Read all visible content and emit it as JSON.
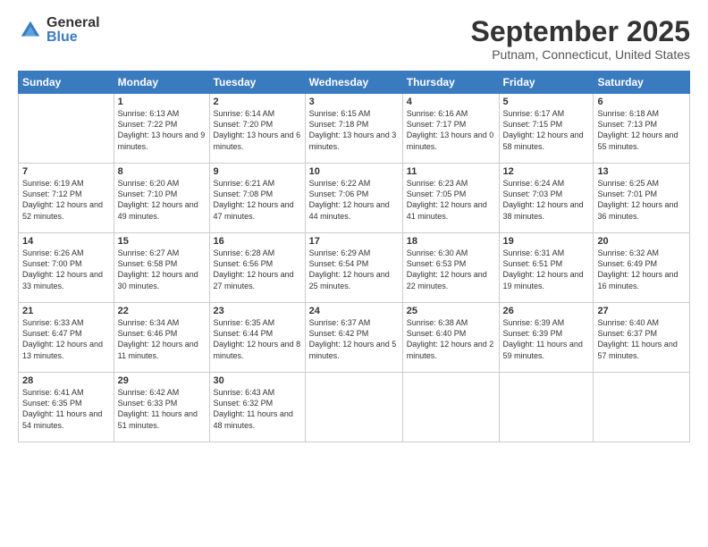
{
  "header": {
    "logo_general": "General",
    "logo_blue": "Blue",
    "title": "September 2025",
    "subtitle": "Putnam, Connecticut, United States"
  },
  "weekdays": [
    "Sunday",
    "Monday",
    "Tuesday",
    "Wednesday",
    "Thursday",
    "Friday",
    "Saturday"
  ],
  "weeks": [
    [
      {
        "day": null,
        "sunrise": null,
        "sunset": null,
        "daylight": null
      },
      {
        "day": "1",
        "sunrise": "Sunrise: 6:13 AM",
        "sunset": "Sunset: 7:22 PM",
        "daylight": "Daylight: 13 hours and 9 minutes."
      },
      {
        "day": "2",
        "sunrise": "Sunrise: 6:14 AM",
        "sunset": "Sunset: 7:20 PM",
        "daylight": "Daylight: 13 hours and 6 minutes."
      },
      {
        "day": "3",
        "sunrise": "Sunrise: 6:15 AM",
        "sunset": "Sunset: 7:18 PM",
        "daylight": "Daylight: 13 hours and 3 minutes."
      },
      {
        "day": "4",
        "sunrise": "Sunrise: 6:16 AM",
        "sunset": "Sunset: 7:17 PM",
        "daylight": "Daylight: 13 hours and 0 minutes."
      },
      {
        "day": "5",
        "sunrise": "Sunrise: 6:17 AM",
        "sunset": "Sunset: 7:15 PM",
        "daylight": "Daylight: 12 hours and 58 minutes."
      },
      {
        "day": "6",
        "sunrise": "Sunrise: 6:18 AM",
        "sunset": "Sunset: 7:13 PM",
        "daylight": "Daylight: 12 hours and 55 minutes."
      }
    ],
    [
      {
        "day": "7",
        "sunrise": "Sunrise: 6:19 AM",
        "sunset": "Sunset: 7:12 PM",
        "daylight": "Daylight: 12 hours and 52 minutes."
      },
      {
        "day": "8",
        "sunrise": "Sunrise: 6:20 AM",
        "sunset": "Sunset: 7:10 PM",
        "daylight": "Daylight: 12 hours and 49 minutes."
      },
      {
        "day": "9",
        "sunrise": "Sunrise: 6:21 AM",
        "sunset": "Sunset: 7:08 PM",
        "daylight": "Daylight: 12 hours and 47 minutes."
      },
      {
        "day": "10",
        "sunrise": "Sunrise: 6:22 AM",
        "sunset": "Sunset: 7:06 PM",
        "daylight": "Daylight: 12 hours and 44 minutes."
      },
      {
        "day": "11",
        "sunrise": "Sunrise: 6:23 AM",
        "sunset": "Sunset: 7:05 PM",
        "daylight": "Daylight: 12 hours and 41 minutes."
      },
      {
        "day": "12",
        "sunrise": "Sunrise: 6:24 AM",
        "sunset": "Sunset: 7:03 PM",
        "daylight": "Daylight: 12 hours and 38 minutes."
      },
      {
        "day": "13",
        "sunrise": "Sunrise: 6:25 AM",
        "sunset": "Sunset: 7:01 PM",
        "daylight": "Daylight: 12 hours and 36 minutes."
      }
    ],
    [
      {
        "day": "14",
        "sunrise": "Sunrise: 6:26 AM",
        "sunset": "Sunset: 7:00 PM",
        "daylight": "Daylight: 12 hours and 33 minutes."
      },
      {
        "day": "15",
        "sunrise": "Sunrise: 6:27 AM",
        "sunset": "Sunset: 6:58 PM",
        "daylight": "Daylight: 12 hours and 30 minutes."
      },
      {
        "day": "16",
        "sunrise": "Sunrise: 6:28 AM",
        "sunset": "Sunset: 6:56 PM",
        "daylight": "Daylight: 12 hours and 27 minutes."
      },
      {
        "day": "17",
        "sunrise": "Sunrise: 6:29 AM",
        "sunset": "Sunset: 6:54 PM",
        "daylight": "Daylight: 12 hours and 25 minutes."
      },
      {
        "day": "18",
        "sunrise": "Sunrise: 6:30 AM",
        "sunset": "Sunset: 6:53 PM",
        "daylight": "Daylight: 12 hours and 22 minutes."
      },
      {
        "day": "19",
        "sunrise": "Sunrise: 6:31 AM",
        "sunset": "Sunset: 6:51 PM",
        "daylight": "Daylight: 12 hours and 19 minutes."
      },
      {
        "day": "20",
        "sunrise": "Sunrise: 6:32 AM",
        "sunset": "Sunset: 6:49 PM",
        "daylight": "Daylight: 12 hours and 16 minutes."
      }
    ],
    [
      {
        "day": "21",
        "sunrise": "Sunrise: 6:33 AM",
        "sunset": "Sunset: 6:47 PM",
        "daylight": "Daylight: 12 hours and 13 minutes."
      },
      {
        "day": "22",
        "sunrise": "Sunrise: 6:34 AM",
        "sunset": "Sunset: 6:46 PM",
        "daylight": "Daylight: 12 hours and 11 minutes."
      },
      {
        "day": "23",
        "sunrise": "Sunrise: 6:35 AM",
        "sunset": "Sunset: 6:44 PM",
        "daylight": "Daylight: 12 hours and 8 minutes."
      },
      {
        "day": "24",
        "sunrise": "Sunrise: 6:37 AM",
        "sunset": "Sunset: 6:42 PM",
        "daylight": "Daylight: 12 hours and 5 minutes."
      },
      {
        "day": "25",
        "sunrise": "Sunrise: 6:38 AM",
        "sunset": "Sunset: 6:40 PM",
        "daylight": "Daylight: 12 hours and 2 minutes."
      },
      {
        "day": "26",
        "sunrise": "Sunrise: 6:39 AM",
        "sunset": "Sunset: 6:39 PM",
        "daylight": "Daylight: 11 hours and 59 minutes."
      },
      {
        "day": "27",
        "sunrise": "Sunrise: 6:40 AM",
        "sunset": "Sunset: 6:37 PM",
        "daylight": "Daylight: 11 hours and 57 minutes."
      }
    ],
    [
      {
        "day": "28",
        "sunrise": "Sunrise: 6:41 AM",
        "sunset": "Sunset: 6:35 PM",
        "daylight": "Daylight: 11 hours and 54 minutes."
      },
      {
        "day": "29",
        "sunrise": "Sunrise: 6:42 AM",
        "sunset": "Sunset: 6:33 PM",
        "daylight": "Daylight: 11 hours and 51 minutes."
      },
      {
        "day": "30",
        "sunrise": "Sunrise: 6:43 AM",
        "sunset": "Sunset: 6:32 PM",
        "daylight": "Daylight: 11 hours and 48 minutes."
      },
      {
        "day": null,
        "sunrise": null,
        "sunset": null,
        "daylight": null
      },
      {
        "day": null,
        "sunrise": null,
        "sunset": null,
        "daylight": null
      },
      {
        "day": null,
        "sunrise": null,
        "sunset": null,
        "daylight": null
      },
      {
        "day": null,
        "sunrise": null,
        "sunset": null,
        "daylight": null
      }
    ]
  ]
}
